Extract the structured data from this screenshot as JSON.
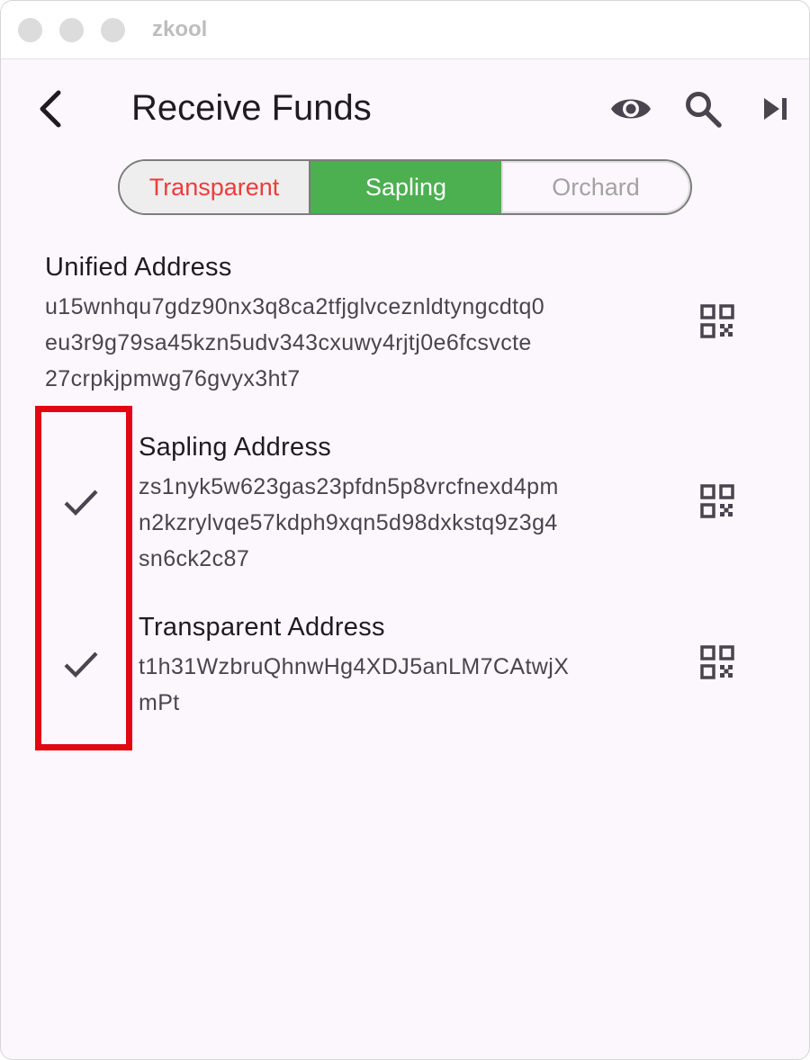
{
  "window": {
    "title": "zkool"
  },
  "header": {
    "title": "Receive Funds",
    "icons": [
      "back-arrow-icon",
      "eye-icon",
      "search-icon",
      "skip-next-icon"
    ]
  },
  "pool_selector": {
    "options": [
      "Transparent",
      "Sapling",
      "Orchard"
    ],
    "selected": "Sapling",
    "colors": {
      "transparent_text": "#ef3b3b",
      "selected_bg": "#4caf50",
      "disabled_text": "#a3a3a3"
    }
  },
  "addresses": {
    "unified": {
      "label": "Unified Address",
      "lines": [
        "u15wnhqu7gdz90nx3q8ca2tfjglvceznldtyngcdtq0",
        "eu3r9g79sa45kzn5udv343cxuwy4rjtj0e6fcsvcte",
        "27crpkjpmwg76gvyx3ht7"
      ]
    },
    "sapling": {
      "label": "Sapling Address",
      "lines": [
        "zs1nyk5w623gas23pfdn5p8vrcfnexd4pm",
        "n2kzrylvqe57kdph9xqn5d98dxkstq9z3g4",
        "sn6ck2c87"
      ]
    },
    "transparent": {
      "label": "Transparent Address",
      "lines": [
        "t1h31WzbruQhnwHg4XDJ5anLM7CAtwjX",
        "mPt"
      ]
    }
  }
}
